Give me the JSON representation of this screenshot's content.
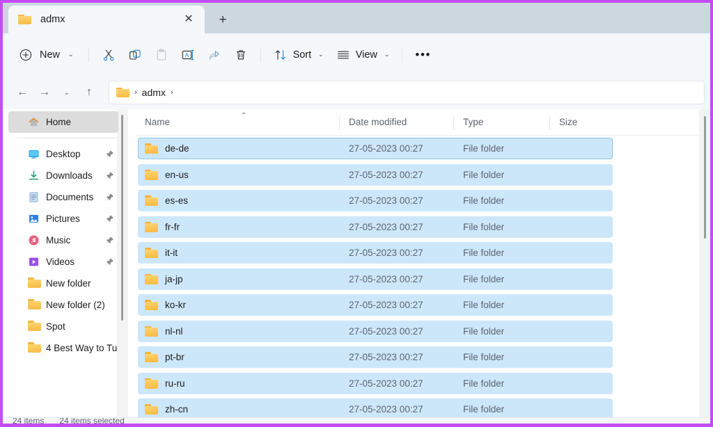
{
  "window": {
    "accent_border_color": "#c44cf5",
    "tabstrip_color": "#ccd7e0",
    "chrome_color": "#f5f7fa",
    "selection_color": "#cde7fa"
  },
  "tab": {
    "title": "admx",
    "folder_icon": "folder-icon",
    "close_icon": "close-icon",
    "close_glyph": "✕",
    "new_tab_icon": "new-tab-icon",
    "new_tab_glyph": "+"
  },
  "toolbar": {
    "new_label": "New",
    "new_icon": "plus-circle-icon",
    "cut_icon": "scissors-icon",
    "copy_icon": "copy-icon",
    "paste_icon": "clipboard-paste-icon",
    "rename_icon": "rename-icon",
    "share_icon": "share-icon",
    "delete_icon": "trash-icon",
    "sort_label": "Sort",
    "sort_icon": "sort-arrows-icon",
    "view_label": "View",
    "view_icon": "view-list-icon",
    "more_label": "•••",
    "chevron": "⌄"
  },
  "addressbar": {
    "back_icon": "arrow-left-icon",
    "back_glyph": "←",
    "forward_icon": "arrow-right-icon",
    "forward_glyph": "→",
    "recent_icon": "chevron-down-icon",
    "recent_glyph": "⌄",
    "up_icon": "arrow-up-icon",
    "up_glyph": "↑",
    "path_folder_icon": "folder-icon",
    "separator": "›",
    "crumb": "admx"
  },
  "sidebar": {
    "items": [
      {
        "label": "Home",
        "icon": "home-icon",
        "selected": true,
        "pinned": false
      },
      {
        "label": "Desktop",
        "icon": "desktop-icon",
        "selected": false,
        "pinned": true
      },
      {
        "label": "Downloads",
        "icon": "downloads-icon",
        "selected": false,
        "pinned": true
      },
      {
        "label": "Documents",
        "icon": "documents-icon",
        "selected": false,
        "pinned": true
      },
      {
        "label": "Pictures",
        "icon": "pictures-icon",
        "selected": false,
        "pinned": true
      },
      {
        "label": "Music",
        "icon": "music-icon",
        "selected": false,
        "pinned": true
      },
      {
        "label": "Videos",
        "icon": "videos-icon",
        "selected": false,
        "pinned": true
      },
      {
        "label": "New folder",
        "icon": "folder-icon",
        "selected": false,
        "pinned": false
      },
      {
        "label": "New folder (2)",
        "icon": "folder-icon",
        "selected": false,
        "pinned": false
      },
      {
        "label": "Spot",
        "icon": "folder-icon",
        "selected": false,
        "pinned": false
      },
      {
        "label": "4 Best Way to Tu",
        "icon": "folder-icon",
        "selected": false,
        "pinned": false
      }
    ]
  },
  "filelist": {
    "columns": [
      {
        "label": "Name",
        "sorted": "asc",
        "sort_glyph": "⌃"
      },
      {
        "label": "Date modified",
        "sorted": ""
      },
      {
        "label": "Type",
        "sorted": ""
      },
      {
        "label": "Size",
        "sorted": ""
      }
    ],
    "rows": [
      {
        "name": "de-de",
        "date": "27-05-2023 00:27",
        "type": "File folder",
        "size": "",
        "icon": "folder-icon",
        "selected": true,
        "focused": true
      },
      {
        "name": "en-us",
        "date": "27-05-2023 00:27",
        "type": "File folder",
        "size": "",
        "icon": "folder-icon",
        "selected": true,
        "focused": false
      },
      {
        "name": "es-es",
        "date": "27-05-2023 00:27",
        "type": "File folder",
        "size": "",
        "icon": "folder-icon",
        "selected": true,
        "focused": false
      },
      {
        "name": "fr-fr",
        "date": "27-05-2023 00:27",
        "type": "File folder",
        "size": "",
        "icon": "folder-icon",
        "selected": true,
        "focused": false
      },
      {
        "name": "it-it",
        "date": "27-05-2023 00:27",
        "type": "File folder",
        "size": "",
        "icon": "folder-icon",
        "selected": true,
        "focused": false
      },
      {
        "name": "ja-jp",
        "date": "27-05-2023 00:27",
        "type": "File folder",
        "size": "",
        "icon": "folder-icon",
        "selected": true,
        "focused": false
      },
      {
        "name": "ko-kr",
        "date": "27-05-2023 00:27",
        "type": "File folder",
        "size": "",
        "icon": "folder-icon",
        "selected": true,
        "focused": false
      },
      {
        "name": "nl-nl",
        "date": "27-05-2023 00:27",
        "type": "File folder",
        "size": "",
        "icon": "folder-icon",
        "selected": true,
        "focused": false
      },
      {
        "name": "pt-br",
        "date": "27-05-2023 00:27",
        "type": "File folder",
        "size": "",
        "icon": "folder-icon",
        "selected": true,
        "focused": false
      },
      {
        "name": "ru-ru",
        "date": "27-05-2023 00:27",
        "type": "File folder",
        "size": "",
        "icon": "folder-icon",
        "selected": true,
        "focused": false
      },
      {
        "name": "zh-cn",
        "date": "27-05-2023 00:27",
        "type": "File folder",
        "size": "",
        "icon": "folder-icon",
        "selected": true,
        "focused": false
      }
    ]
  },
  "statusbar": {
    "item_count": "24 items",
    "selected_count": "24 items selected"
  }
}
